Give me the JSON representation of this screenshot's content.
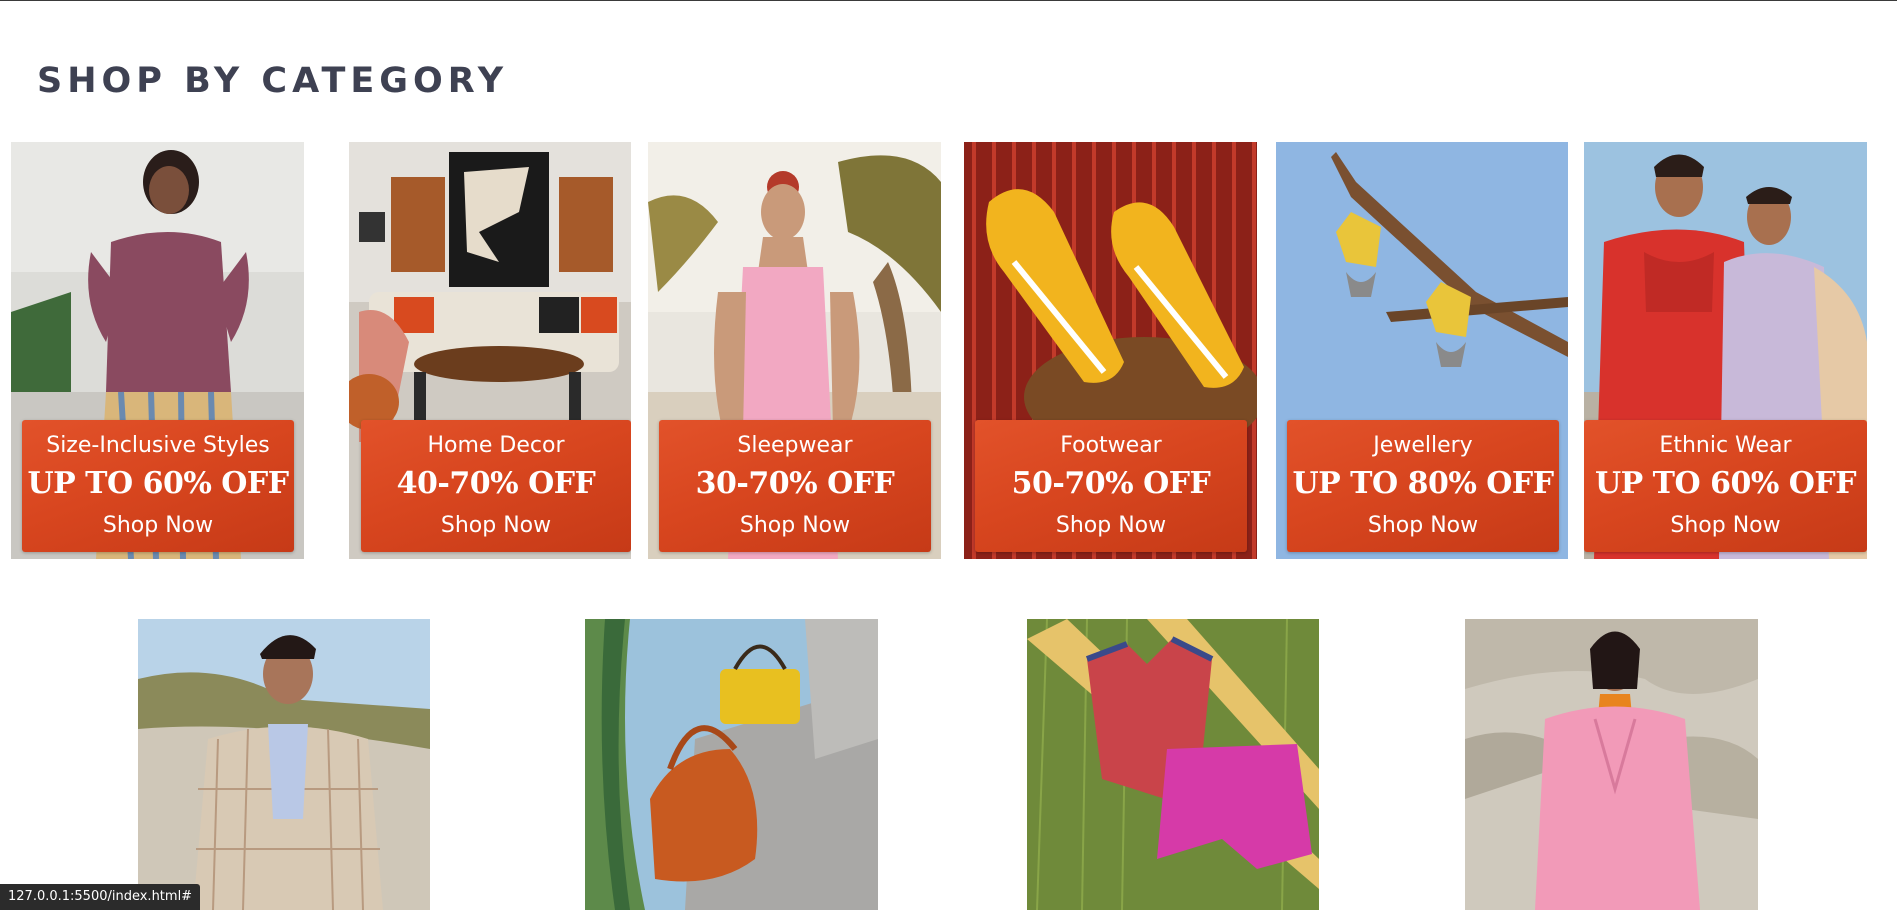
{
  "section": {
    "title": "SHOP BY CATEGORY"
  },
  "row1": [
    {
      "name": "Size-Inclusive Styles",
      "offer": "UP TO 60% OFF",
      "cta": "Shop Now"
    },
    {
      "name": "Home Decor",
      "offer": "40-70% OFF",
      "cta": "Shop Now"
    },
    {
      "name": "Sleepwear",
      "offer": "30-70% OFF",
      "cta": "Shop Now"
    },
    {
      "name": "Footwear",
      "offer": "50-70% OFF",
      "cta": "Shop Now"
    },
    {
      "name": "Jewellery",
      "offer": "UP TO 80% OFF",
      "cta": "Shop Now"
    },
    {
      "name": "Ethnic Wear",
      "offer": "UP TO 60% OFF",
      "cta": "Shop Now"
    }
  ],
  "status_bar": {
    "url": "127.0.0.1:5500/index.html#"
  },
  "colors": {
    "title": "#3e4152",
    "banner": "#d8461f",
    "status_bar": "#2b2b2b"
  }
}
